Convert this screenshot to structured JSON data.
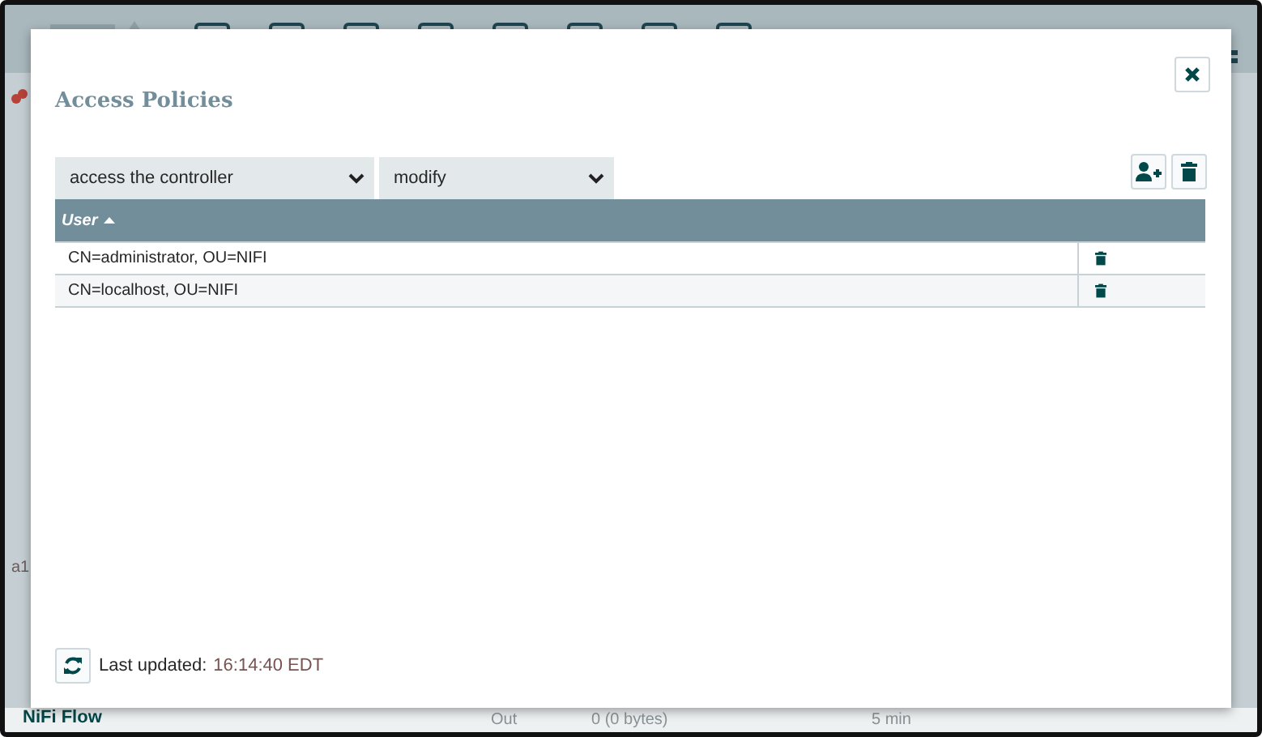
{
  "background": {
    "sidebar_label": "a1",
    "breadcrumb": "NiFi Flow",
    "status_texts": [
      "Out",
      "0 (0 bytes)",
      "5 min"
    ]
  },
  "dialog": {
    "title": "Access Policies",
    "resource_select": {
      "value": "access the controller"
    },
    "action_select": {
      "value": "modify"
    },
    "table": {
      "columns": [
        {
          "label": "User",
          "sort_ascending": true
        }
      ],
      "rows": [
        {
          "user": "CN=administrator, OU=NIFI"
        },
        {
          "user": "CN=localhost, OU=NIFI"
        }
      ]
    },
    "footer": {
      "label": "Last updated:",
      "time": "16:14:40 EDT"
    }
  }
}
